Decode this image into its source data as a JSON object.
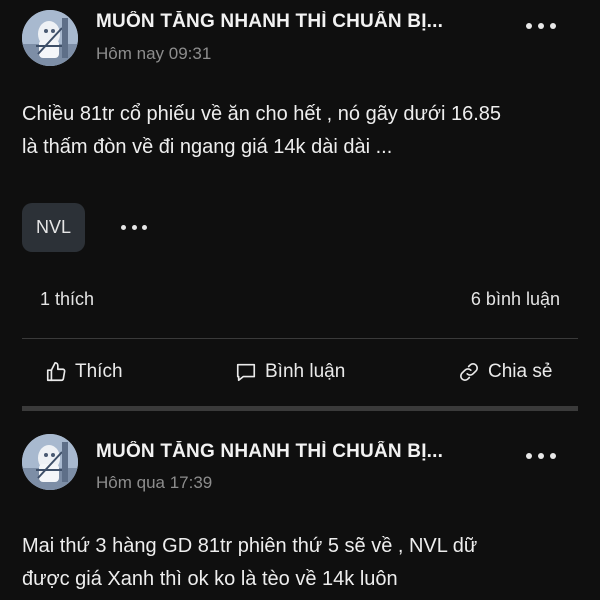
{
  "posts": [
    {
      "author": "MUỐN TĂNG NHANH THÌ CHUẨN BỊ...",
      "time": "Hôm nay 09:31",
      "content_lines": [
        "Chiều 81tr cổ phiếu về ăn cho hết , nó gãy dưới 16.85",
        "là thấm đòn về đi ngang giá 14k dài dài ..."
      ],
      "tag": "NVL",
      "likes": "1 thích",
      "comments": "6 bình luận",
      "actions": {
        "like": "Thích",
        "comment": "Bình luận",
        "share": "Chia sẻ"
      }
    },
    {
      "author": "MUỐN TĂNG NHANH THÌ CHUẨN BỊ...",
      "time": "Hôm qua 17:39",
      "content_lines": [
        "Mai thứ 3 hàng GD 81tr phiên thứ 5 sẽ về , NVL dữ",
        "được giá Xanh thì ok ko là tèo về 14k luôn"
      ]
    }
  ],
  "icons": {
    "more": "more-horizontal-icon",
    "like": "thumbs-up-icon",
    "comment": "comment-icon",
    "share": "link-icon"
  },
  "colors": {
    "background": "#0f0f0f",
    "text": "#ececec",
    "muted": "#8d8d8d",
    "tag_bg": "#2c3137",
    "divider": "#3a3a3a"
  }
}
